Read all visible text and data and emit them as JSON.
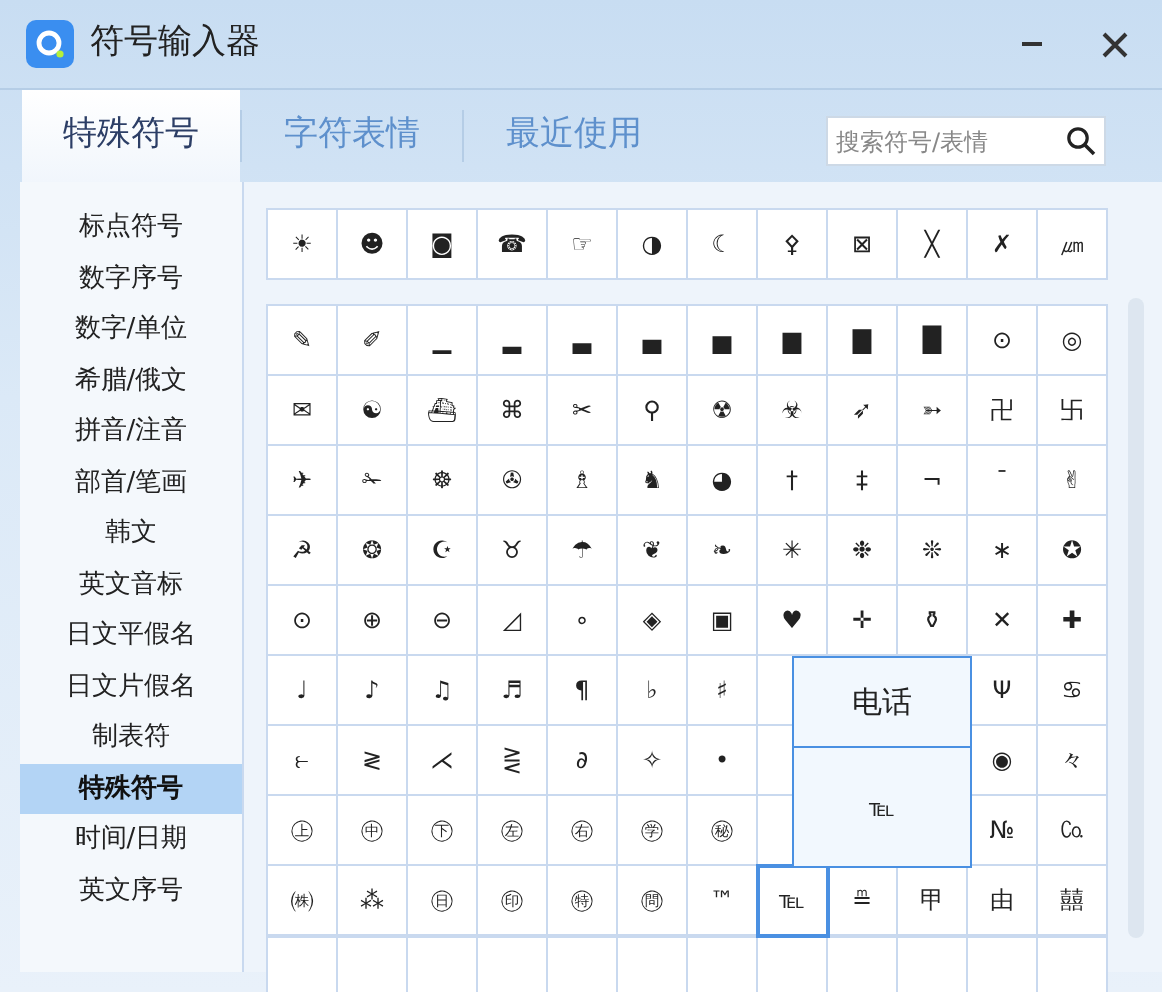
{
  "window": {
    "title": "符号输入器"
  },
  "tabs": [
    {
      "label": "特殊符号",
      "selected": true
    },
    {
      "label": "字符表情",
      "selected": false
    },
    {
      "label": "最近使用",
      "selected": false
    }
  ],
  "search": {
    "placeholder": "搜索符号/表情"
  },
  "categories": [
    {
      "label": "标点符号",
      "selected": false
    },
    {
      "label": "数字序号",
      "selected": false
    },
    {
      "label": "数字/单位",
      "selected": false
    },
    {
      "label": "希腊/俄文",
      "selected": false
    },
    {
      "label": "拼音/注音",
      "selected": false
    },
    {
      "label": "部首/笔画",
      "selected": false
    },
    {
      "label": "韩文",
      "selected": false
    },
    {
      "label": "英文音标",
      "selected": false
    },
    {
      "label": "日文平假名",
      "selected": false
    },
    {
      "label": "日文片假名",
      "selected": false
    },
    {
      "label": "制表符",
      "selected": false
    },
    {
      "label": "特殊符号",
      "selected": true
    },
    {
      "label": "时间/日期",
      "selected": false
    },
    {
      "label": "英文序号",
      "selected": false
    }
  ],
  "top_row": [
    "☀",
    "☻",
    "◙",
    "☎",
    "☞",
    "◑",
    "☾",
    "⚴",
    "⊠",
    "╳",
    "✗",
    "㎛"
  ],
  "symbol_rows": [
    [
      {
        "symbol": "✎",
        "selected": false
      },
      {
        "symbol": "✐",
        "selected": false
      },
      {
        "symbol": "▁",
        "selected": false
      },
      {
        "symbol": "▂",
        "selected": false
      },
      {
        "symbol": "▃",
        "selected": false
      },
      {
        "symbol": "▄",
        "selected": false
      },
      {
        "symbol": "▅",
        "selected": false
      },
      {
        "symbol": "▆",
        "selected": false
      },
      {
        "symbol": "▇",
        "selected": false
      },
      {
        "symbol": "█",
        "selected": false
      },
      {
        "symbol": "⊙",
        "selected": false
      },
      {
        "symbol": "◎",
        "selected": false
      }
    ],
    [
      {
        "symbol": "✉",
        "selected": false
      },
      {
        "symbol": "☯",
        "selected": false
      },
      {
        "symbol": "⛴",
        "selected": false
      },
      {
        "symbol": "⌘",
        "selected": false
      },
      {
        "symbol": "✂",
        "selected": false
      },
      {
        "symbol": "⚲",
        "selected": false
      },
      {
        "symbol": "☢",
        "selected": false
      },
      {
        "symbol": "☣",
        "selected": false
      },
      {
        "symbol": "➶",
        "selected": false
      },
      {
        "symbol": "➳",
        "selected": false
      },
      {
        "symbol": "卍",
        "selected": false
      },
      {
        "symbol": "卐",
        "selected": false
      }
    ],
    [
      {
        "symbol": "✈",
        "selected": false
      },
      {
        "symbol": "✁",
        "selected": false
      },
      {
        "symbol": "☸",
        "selected": false
      },
      {
        "symbol": "✇",
        "selected": false
      },
      {
        "symbol": "♗",
        "selected": false
      },
      {
        "symbol": "♞",
        "selected": false
      },
      {
        "symbol": "◕",
        "selected": false
      },
      {
        "symbol": "†",
        "selected": false
      },
      {
        "symbol": "‡",
        "selected": false
      },
      {
        "symbol": "¬",
        "selected": false
      },
      {
        "symbol": "¯",
        "selected": false
      },
      {
        "symbol": "✌",
        "selected": false
      }
    ],
    [
      {
        "symbol": "☭",
        "selected": false
      },
      {
        "symbol": "❂",
        "selected": false
      },
      {
        "symbol": "☪",
        "selected": false
      },
      {
        "symbol": "♉",
        "selected": false
      },
      {
        "symbol": "☂",
        "selected": false
      },
      {
        "symbol": "❦",
        "selected": false
      },
      {
        "symbol": "❧",
        "selected": false
      },
      {
        "symbol": "✳",
        "selected": false
      },
      {
        "symbol": "❉",
        "selected": false
      },
      {
        "symbol": "❊",
        "selected": false
      },
      {
        "symbol": "∗",
        "selected": false
      },
      {
        "symbol": "✪",
        "selected": false
      }
    ],
    [
      {
        "symbol": "⊙",
        "selected": false
      },
      {
        "symbol": "⊕",
        "selected": false
      },
      {
        "symbol": "⊖",
        "selected": false
      },
      {
        "symbol": "◿",
        "selected": false
      },
      {
        "symbol": "∘",
        "selected": false
      },
      {
        "symbol": "◈",
        "selected": false
      },
      {
        "symbol": "▣",
        "selected": false
      },
      {
        "symbol": "♥",
        "selected": false
      },
      {
        "symbol": "✛",
        "selected": false
      },
      {
        "symbol": "⚱",
        "selected": false
      },
      {
        "symbol": "✕",
        "selected": false
      },
      {
        "symbol": "✚",
        "selected": false
      }
    ],
    [
      {
        "symbol": "♩",
        "selected": false
      },
      {
        "symbol": "♪",
        "selected": false
      },
      {
        "symbol": "♫",
        "selected": false
      },
      {
        "symbol": "♬",
        "selected": false
      },
      {
        "symbol": "¶",
        "selected": false
      },
      {
        "symbol": "♭",
        "selected": false
      },
      {
        "symbol": "♯",
        "selected": false
      },
      null,
      null,
      null,
      {
        "symbol": "Ψ",
        "selected": false
      },
      {
        "symbol": "♋",
        "selected": false
      }
    ],
    [
      {
        "symbol": "⥼",
        "selected": false
      },
      {
        "symbol": "≷",
        "selected": false
      },
      {
        "symbol": "⋌",
        "selected": false
      },
      {
        "symbol": "⋛",
        "selected": false
      },
      {
        "symbol": "∂",
        "selected": false
      },
      {
        "symbol": "✧",
        "selected": false
      },
      {
        "symbol": "•",
        "selected": false
      },
      null,
      null,
      null,
      {
        "symbol": "◉",
        "selected": false
      },
      {
        "symbol": "々",
        "selected": false
      }
    ],
    [
      {
        "symbol": "㊤",
        "selected": false
      },
      {
        "symbol": "㊥",
        "selected": false
      },
      {
        "symbol": "㊦",
        "selected": false
      },
      {
        "symbol": "㊧",
        "selected": false
      },
      {
        "symbol": "㊨",
        "selected": false
      },
      {
        "symbol": "㊫",
        "selected": false
      },
      {
        "symbol": "㊙",
        "selected": false
      },
      null,
      null,
      null,
      {
        "symbol": "№",
        "selected": false
      },
      {
        "symbol": "㏇",
        "selected": false
      }
    ],
    [
      {
        "symbol": "㈱",
        "selected": false
      },
      {
        "symbol": "⁂",
        "selected": false
      },
      {
        "symbol": "㊐",
        "selected": false
      },
      {
        "symbol": "㊞",
        "selected": false
      },
      {
        "symbol": "㊕",
        "selected": false
      },
      {
        "symbol": "㉄",
        "selected": false
      },
      {
        "symbol": "™",
        "selected": false
      },
      {
        "symbol": "℡",
        "selected": true
      },
      {
        "symbol": "≞",
        "selected": false
      },
      {
        "symbol": "甲",
        "selected": false
      },
      {
        "symbol": "由",
        "selected": false
      },
      {
        "symbol": "囍",
        "selected": false
      }
    ]
  ],
  "preview": {
    "name": "电话",
    "symbol": "℡"
  }
}
